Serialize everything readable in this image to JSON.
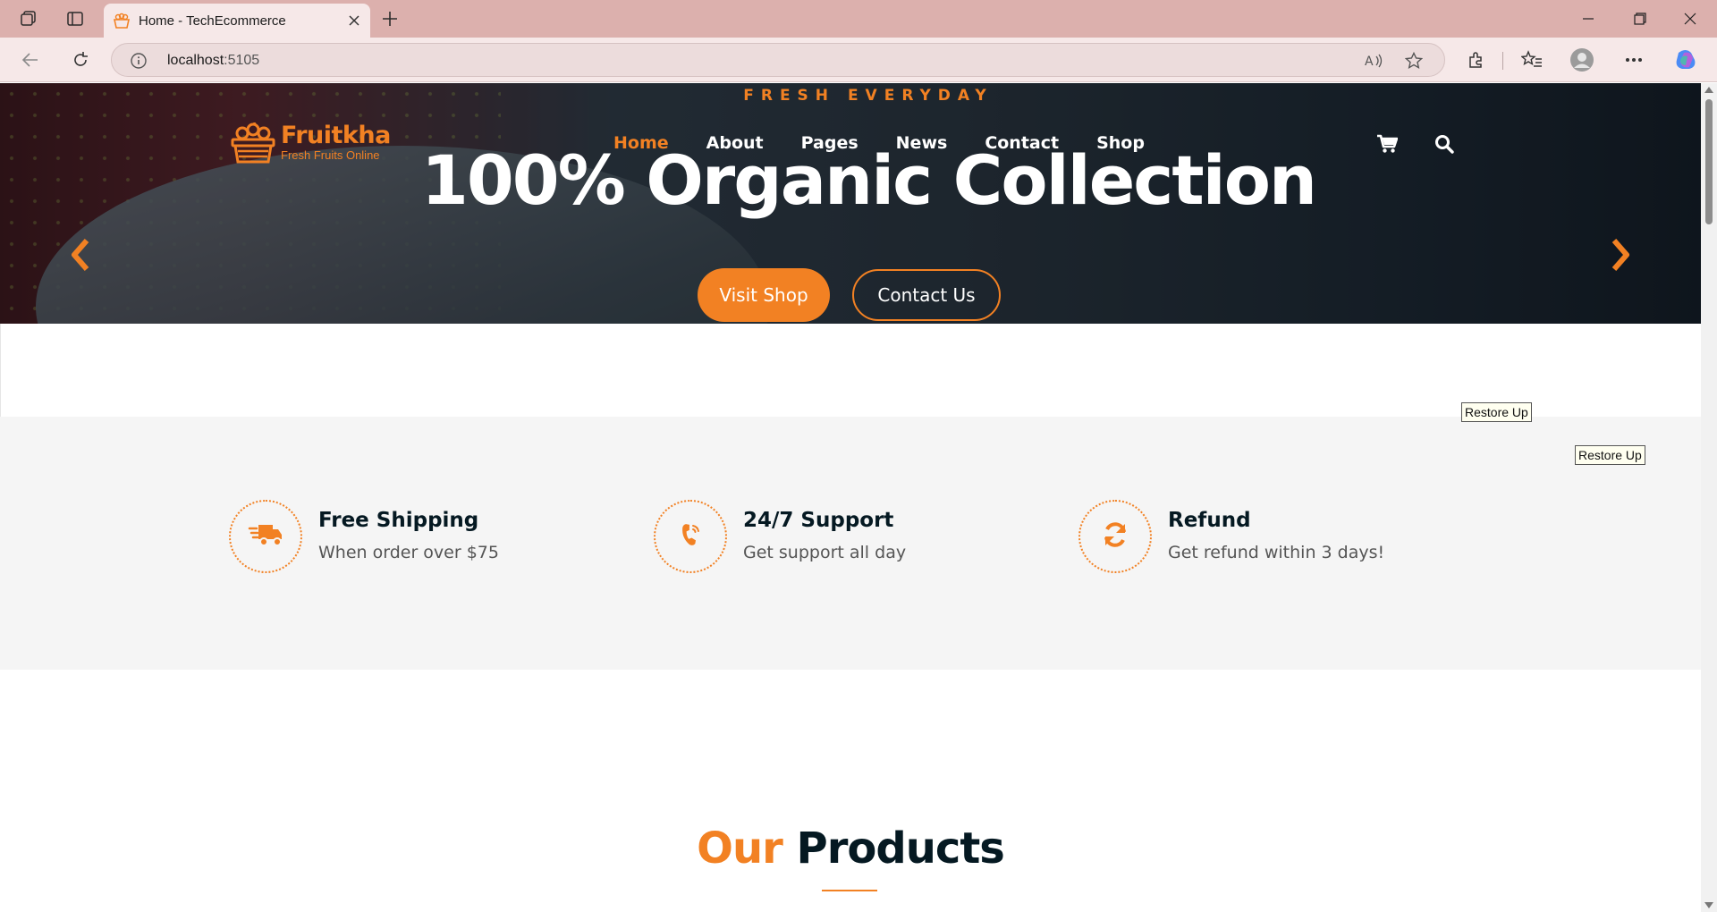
{
  "browser": {
    "tab_title": "Home - TechEcommerce",
    "address_host": "localhost",
    "address_port": ":5105"
  },
  "site": {
    "brand_name": "Fruitkha",
    "brand_tagline": "Fresh Fruits Online",
    "accent_color": "#f28123",
    "dark_color": "#051922"
  },
  "nav": {
    "items": [
      {
        "label": "Home",
        "active": true
      },
      {
        "label": "About"
      },
      {
        "label": "Pages"
      },
      {
        "label": "News"
      },
      {
        "label": "Contact"
      },
      {
        "label": "Shop"
      }
    ],
    "icons": [
      "shopping-cart-icon",
      "search-icon"
    ]
  },
  "hero": {
    "subtitle": "FRESH EVERYDAY",
    "title": "100% Organic Collection",
    "primary_button": "Visit Shop",
    "secondary_button": "Contact Us"
  },
  "overlays": {
    "restore_1": "Restore Up",
    "restore_2": "Restore Up"
  },
  "features": [
    {
      "icon": "truck-icon",
      "title": "Free Shipping",
      "subtitle": "When order over $75"
    },
    {
      "icon": "phone-icon",
      "title": "24/7 Support",
      "subtitle": "Get support all day"
    },
    {
      "icon": "refresh-icon",
      "title": "Refund",
      "subtitle": "Get refund within 3 days!"
    }
  ],
  "products": {
    "heading_accent": "Our",
    "heading_rest": "Products"
  }
}
